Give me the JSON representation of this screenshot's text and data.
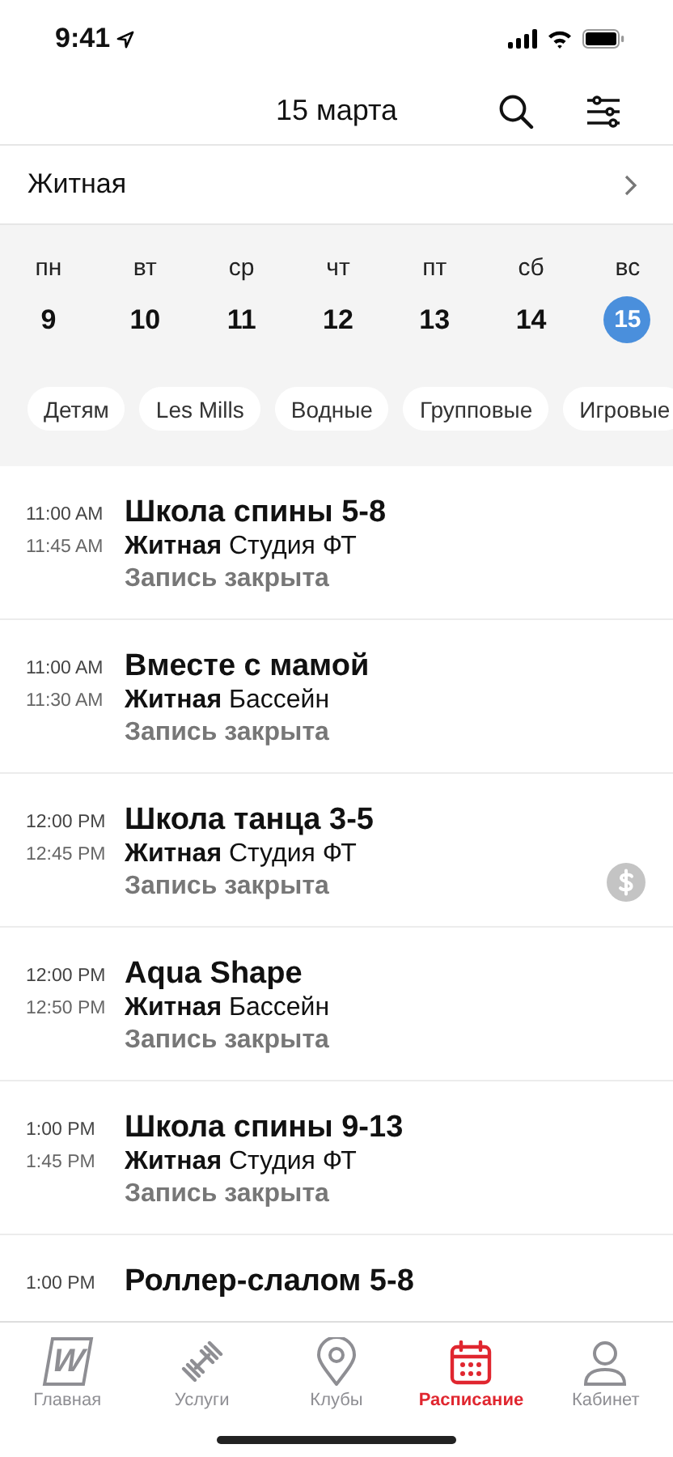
{
  "status_bar": {
    "time": "9:41"
  },
  "header": {
    "title": "15 марта"
  },
  "club": {
    "name": "Житная"
  },
  "week": [
    {
      "weekday": "пн",
      "day": "9",
      "selected": false
    },
    {
      "weekday": "вт",
      "day": "10",
      "selected": false
    },
    {
      "weekday": "ср",
      "day": "11",
      "selected": false
    },
    {
      "weekday": "чт",
      "day": "12",
      "selected": false
    },
    {
      "weekday": "пт",
      "day": "13",
      "selected": false
    },
    {
      "weekday": "сб",
      "day": "14",
      "selected": false
    },
    {
      "weekday": "вс",
      "day": "15",
      "selected": true
    }
  ],
  "filters": [
    "Детям",
    "Les Mills",
    "Водные",
    "Групповые",
    "Игровые"
  ],
  "sessions": [
    {
      "start": "11:00 AM",
      "end": "11:45 AM",
      "title": "Школа спины 5-8",
      "club": "Житная",
      "room": "Студия ФТ",
      "status": "Запись закрыта",
      "paid": false
    },
    {
      "start": "11:00 AM",
      "end": "11:30 AM",
      "title": "Вместе с мамой",
      "club": "Житная",
      "room": "Бассейн",
      "status": "Запись закрыта",
      "paid": false
    },
    {
      "start": "12:00 PM",
      "end": "12:45 PM",
      "title": "Школа танца 3-5",
      "club": "Житная",
      "room": "Студия ФТ",
      "status": "Запись закрыта",
      "paid": true
    },
    {
      "start": "12:00 PM",
      "end": "12:50 PM",
      "title": "Aqua Shape",
      "club": "Житная",
      "room": "Бассейн",
      "status": "Запись закрыта",
      "paid": false
    },
    {
      "start": "1:00 PM",
      "end": "1:45 PM",
      "title": "Школа спины 9-13",
      "club": "Житная",
      "room": "Студия ФТ",
      "status": "Запись закрыта",
      "paid": false
    },
    {
      "start": "1:00 PM",
      "title": "Роллер-слалом 5-8"
    }
  ],
  "tab_bar": [
    {
      "kind": "home",
      "label": "Главная",
      "logo": "W",
      "selected": false
    },
    {
      "kind": "services",
      "label": "Услуги",
      "selected": false
    },
    {
      "kind": "clubs",
      "label": "Клубы",
      "selected": false
    },
    {
      "kind": "schedule",
      "label": "Расписание",
      "selected": true
    },
    {
      "kind": "profile",
      "label": "Кабинет",
      "selected": false
    }
  ]
}
